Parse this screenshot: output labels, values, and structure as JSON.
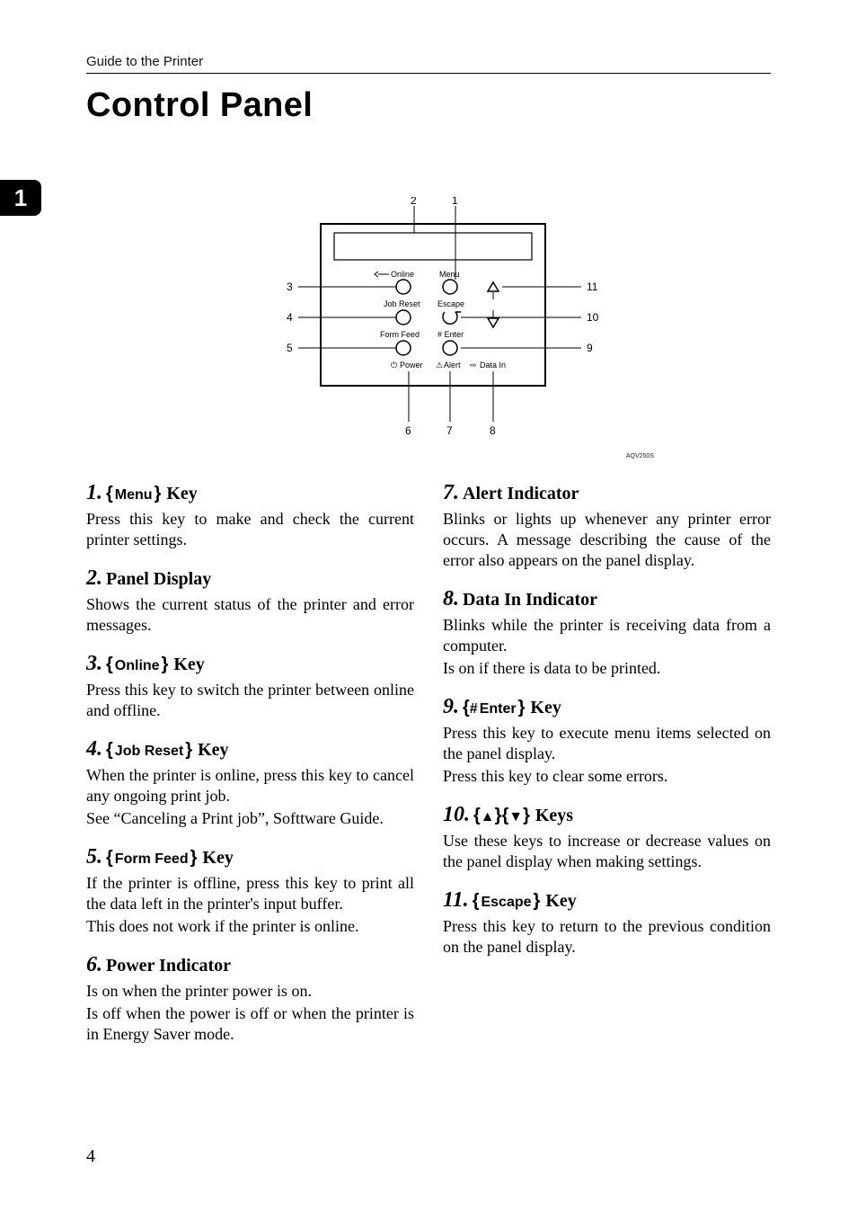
{
  "header": "Guide to the Printer",
  "title": "Control Panel",
  "chapter_tab": "1",
  "page_number": "4",
  "diagram": {
    "code": "AQV250S",
    "callouts": [
      "1",
      "2",
      "3",
      "4",
      "5",
      "6",
      "7",
      "8",
      "9",
      "10",
      "11"
    ],
    "labels": {
      "online": "Online",
      "menu": "Menu",
      "job_reset": "Job Reset",
      "escape": "Escape",
      "form_feed": "Form Feed",
      "enter": "# Enter",
      "power": "Power",
      "alert": "Alert",
      "data_in": "Data In"
    }
  },
  "items": {
    "i1": {
      "num": "1.",
      "key": "Menu",
      "tail": "Key",
      "body": [
        "Press this key to make and check the current printer settings."
      ]
    },
    "i2": {
      "num": "2.",
      "head": "Panel Display",
      "body": [
        "Shows the current status of the printer and error messages."
      ]
    },
    "i3": {
      "num": "3.",
      "key": "Online",
      "tail": "Key",
      "body": [
        "Press this key to switch the printer between online and offline."
      ]
    },
    "i4": {
      "num": "4.",
      "key": "Job Reset",
      "tail": "Key",
      "body": [
        "When the printer is online, press this key to cancel any ongoing print job.",
        "See “Canceling a Print job”, Softtware Guide."
      ]
    },
    "i5": {
      "num": "5.",
      "key": "Form Feed",
      "tail": "Key",
      "body": [
        "If the printer is offline, press this key to print all the data left in the printer's input buffer.",
        "This does not work if the printer is online."
      ]
    },
    "i6": {
      "num": "6.",
      "head": "Power Indicator",
      "body": [
        "Is on when the printer power is on.",
        "Is off when the power is off or when the printer is in Energy Saver mode."
      ]
    },
    "i7": {
      "num": "7.",
      "head": "Alert Indicator",
      "body": [
        "Blinks or lights up whenever any printer error occurs. A message describing the cause of the error also appears on the panel display."
      ]
    },
    "i8": {
      "num": "8.",
      "head": "Data In Indicator",
      "body": [
        "Blinks while the printer is receiving data from a computer.",
        "Is on if there is data to be printed."
      ]
    },
    "i9": {
      "num": "9.",
      "hash": "#",
      "key": "Enter",
      "tail": "Key",
      "body": [
        "Press this key to execute menu items selected on the panel display.",
        "Press this key to clear some errors."
      ]
    },
    "i10": {
      "num": "10.",
      "arrows": [
        "▲",
        "▼"
      ],
      "tail": "Keys",
      "body": [
        "Use these keys to increase or decrease values on the panel display when making settings."
      ]
    },
    "i11": {
      "num": "11.",
      "key": "Escape",
      "tail": "Key",
      "body": [
        "Press this key to return to the previous condition on the panel display."
      ]
    }
  }
}
